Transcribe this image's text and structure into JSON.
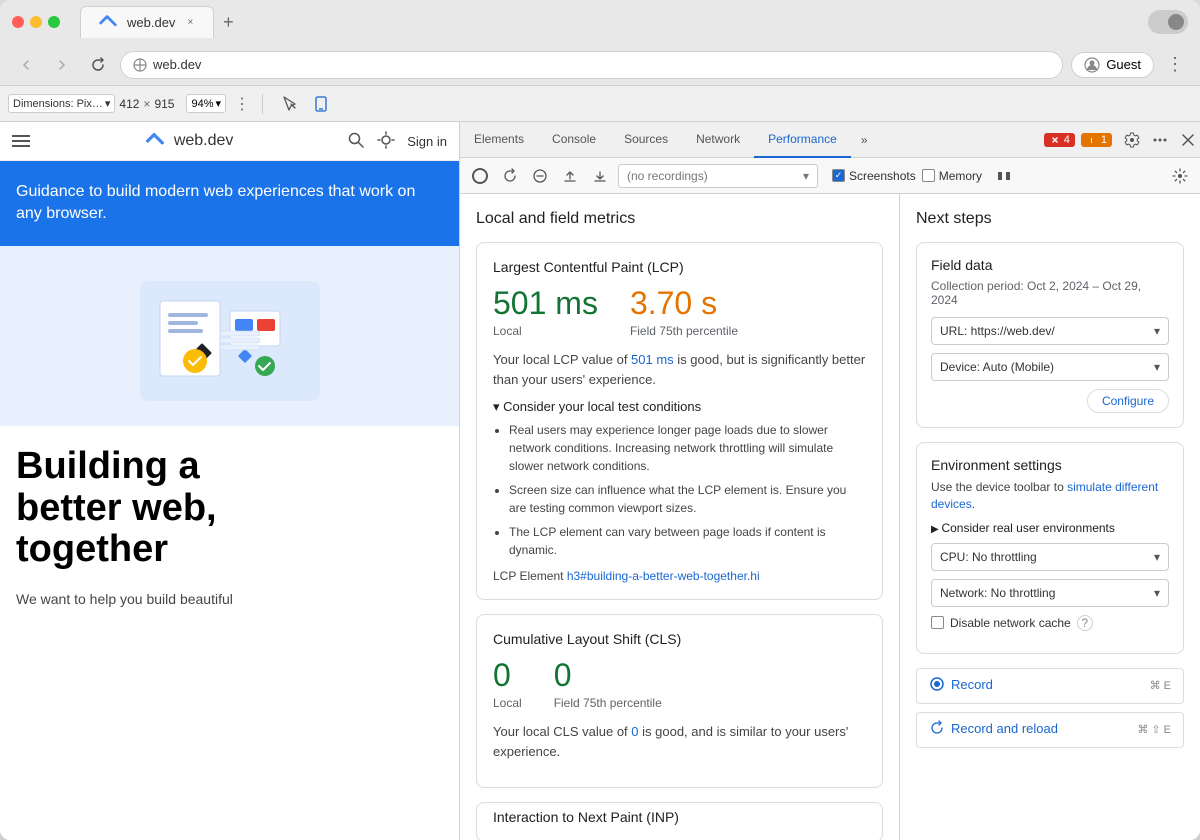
{
  "browser": {
    "title": "web.dev",
    "url": "web.dev",
    "tab_close": "×",
    "new_tab": "+",
    "nav_back": "‹",
    "nav_forward": "›",
    "nav_refresh": "↻",
    "nav_more": "⋮",
    "guest_label": "Guest",
    "more_options": "⋮"
  },
  "devtools_toolbar": {
    "dimensions_label": "Dimensions: Pix…",
    "width": "412",
    "cross": "×",
    "height": "915",
    "zoom": "94%",
    "more_icon": "⋮",
    "inspect_icon": "⊹",
    "device_icon": "▭"
  },
  "devtools_tabs": {
    "elements": "Elements",
    "console": "Console",
    "sources": "Sources",
    "network": "Network",
    "performance": "Performance",
    "more": "»",
    "errors_count": "4",
    "warnings_count": "1"
  },
  "recording_bar": {
    "no_recordings": "(no recordings)",
    "screenshots_label": "Screenshots",
    "memory_label": "Memory"
  },
  "webpage": {
    "logo_text": "web.dev",
    "sign_in": "Sign in",
    "hero_text": "Guidance to build modern web experiences that work on any browser.",
    "headline": "Building a\nbetter web,\ntogether",
    "subtext": "We want to help you build beautiful"
  },
  "metrics": {
    "title": "Local and field metrics",
    "lcp": {
      "title": "Largest Contentful Paint (LCP)",
      "local_value": "501 ms",
      "field_value": "3.70 s",
      "local_label": "Local",
      "field_label": "Field 75th percentile",
      "description": "Your local LCP value of 501 ms is good, but is significantly better than your users' experience.",
      "considerations_title": "Consider your local test conditions",
      "bullets": [
        "Real users may experience longer page loads due to slower network conditions. Increasing network throttling will simulate slower network conditions.",
        "Screen size can influence what the LCP element is. Ensure you are testing common viewport sizes.",
        "The LCP element can vary between page loads if content is dynamic."
      ],
      "lcp_element_label": "LCP Element",
      "lcp_element_link": "h3#building-a-better-web-together.hi"
    },
    "cls": {
      "title": "Cumulative Layout Shift (CLS)",
      "local_value": "0",
      "field_value": "0",
      "local_label": "Local",
      "field_label": "Field 75th percentile",
      "description": "Your local CLS value of 0 is good, and is similar to your users' experience."
    },
    "inp": {
      "title": "Interaction to Next Paint (INP)"
    }
  },
  "next_steps": {
    "title": "Next steps",
    "field_data": {
      "title": "Field data",
      "subtitle": "Collection period: Oct 2, 2024 – Oct 29, 2024",
      "url_label": "URL: https://web.dev/",
      "device_label": "Device: Auto (Mobile)",
      "configure_label": "Configure"
    },
    "env_settings": {
      "title": "Environment settings",
      "desc1": "Use the device toolbar to",
      "link_text": "simulate different devices",
      "desc2": ".",
      "consider_label": "Consider real user environments",
      "cpu_label": "CPU: No throttling",
      "network_label": "Network: No throttling",
      "disable_cache_label": "Disable network cache"
    },
    "record": {
      "label": "Record",
      "shortcut": "⌘ E",
      "reload_label": "Record and reload",
      "reload_shortcut": "⌘ ⇧ E"
    }
  }
}
